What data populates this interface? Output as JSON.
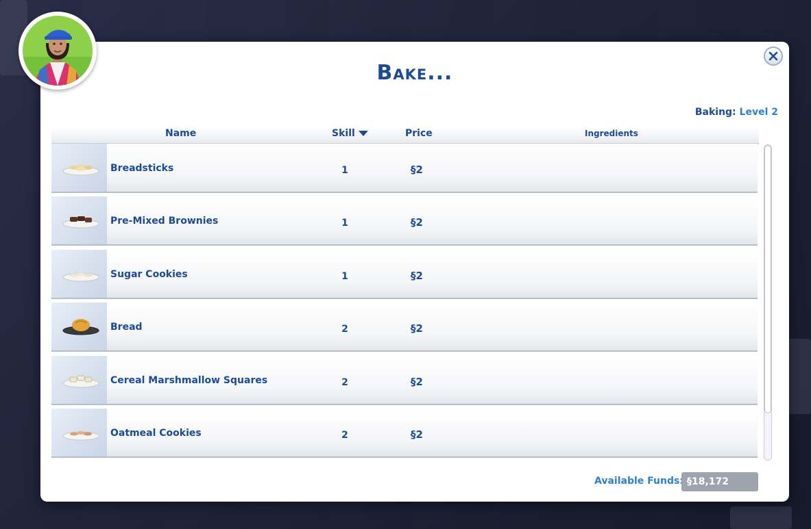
{
  "dialog": {
    "title": "Bake..."
  },
  "skill": {
    "label": "Baking:",
    "value": "Level 2"
  },
  "columns": {
    "name": "Name",
    "skill": "Skill",
    "price": "Price",
    "ingredients": "Ingredients"
  },
  "currency_symbol": "§",
  "recipes": [
    {
      "name": "Breadsticks",
      "skill": "1",
      "price": "2",
      "icon": "breadsticks-plate"
    },
    {
      "name": "Pre-Mixed Brownies",
      "skill": "1",
      "price": "2",
      "icon": "brownies-plate"
    },
    {
      "name": "Sugar Cookies",
      "skill": "1",
      "price": "2",
      "icon": "cookies-plate"
    },
    {
      "name": "Bread",
      "skill": "2",
      "price": "2",
      "icon": "bread-plate"
    },
    {
      "name": "Cereal Marshmallow Squares",
      "skill": "2",
      "price": "2",
      "icon": "squares-plate"
    },
    {
      "name": "Oatmeal Cookies",
      "skill": "2",
      "price": "2",
      "icon": "oatmeal-cookies-plate"
    }
  ],
  "funds": {
    "label": "Available Funds:",
    "value": "18,172"
  },
  "colors": {
    "title": "#1c4a93",
    "accent": "#2d7fd0",
    "funds_box": "#9ea4ad"
  }
}
